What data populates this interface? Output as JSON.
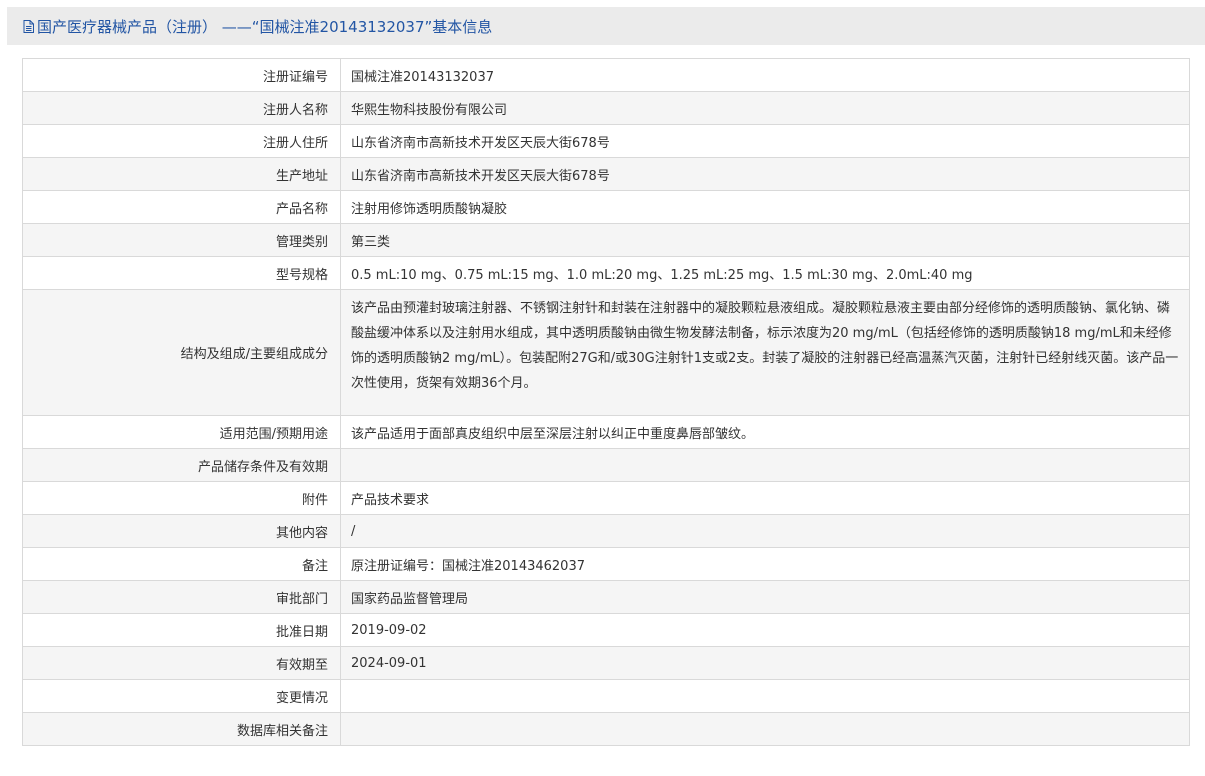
{
  "header": {
    "icon": "document-icon",
    "title": "国产医疗器械产品（注册） ——“国械注准20143132037”基本信息"
  },
  "rows": [
    {
      "label": "注册证编号",
      "value": "国械注准20143132037"
    },
    {
      "label": "注册人名称",
      "value": "华熙生物科技股份有限公司"
    },
    {
      "label": "注册人住所",
      "value": "山东省济南市高新技术开发区天辰大街678号"
    },
    {
      "label": "生产地址",
      "value": "山东省济南市高新技术开发区天辰大街678号"
    },
    {
      "label": "产品名称",
      "value": "注射用修饰透明质酸钠凝胶"
    },
    {
      "label": "管理类别",
      "value": "第三类"
    },
    {
      "label": "型号规格",
      "value": "0.5 mL:10 mg、0.75 mL:15 mg、1.0 mL:20 mg、1.25 mL:25 mg、1.5 mL:30 mg、2.0mL:40 mg"
    },
    {
      "label": "结构及组成/主要组成成分",
      "value": "该产品由预灌封玻璃注射器、不锈钢注射针和封装在注射器中的凝胶颗粒悬液组成。凝胶颗粒悬液主要由部分经修饰的透明质酸钠、氯化钠、磷酸盐缓冲体系以及注射用水组成，其中透明质酸钠由微生物发酵法制备，标示浓度为20 mg/mL（包括经修饰的透明质酸钠18 mg/mL和未经修饰的透明质酸钠2 mg/mL）。包装配附27G和/或30G注射针1支或2支。封装了凝胶的注射器已经高温蒸汽灭菌，注射针已经射线灭菌。该产品一次性使用，货架有效期36个月。"
    },
    {
      "label": "适用范围/预期用途",
      "value": "该产品适用于面部真皮组织中层至深层注射以纠正中重度鼻唇部皱纹。"
    },
    {
      "label": "产品储存条件及有效期",
      "value": ""
    },
    {
      "label": "附件",
      "value": "产品技术要求"
    },
    {
      "label": "其他内容",
      "value": "/"
    },
    {
      "label": "备注",
      "value": "原注册证编号：国械注准20143462037"
    },
    {
      "label": "审批部门",
      "value": "国家药品监督管理局"
    },
    {
      "label": "批准日期",
      "value": "2019-09-02"
    },
    {
      "label": "有效期至",
      "value": "2024-09-01"
    },
    {
      "label": "变更情况",
      "value": ""
    },
    {
      "label": "数据库相关备注",
      "value": ""
    }
  ]
}
